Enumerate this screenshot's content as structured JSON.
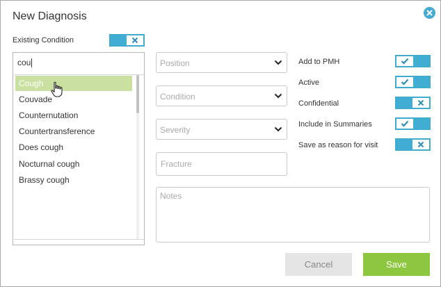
{
  "dialog": {
    "title": "New Diagnosis",
    "close_icon": "close-circle-icon"
  },
  "existing_condition": {
    "label": "Existing Condition",
    "state": "off"
  },
  "search": {
    "value": "cou",
    "results": [
      {
        "label": "Cough",
        "selected": true
      },
      {
        "label": "Couvade",
        "selected": false
      },
      {
        "label": "Counternutation",
        "selected": false
      },
      {
        "label": "Countertransference",
        "selected": false
      },
      {
        "label": "Does cough",
        "selected": false
      },
      {
        "label": "Nocturnal cough",
        "selected": false
      },
      {
        "label": "Brassy cough",
        "selected": false
      }
    ]
  },
  "fields": {
    "position_placeholder": "Position",
    "condition_placeholder": "Condition",
    "severity_placeholder": "Severity",
    "fracture_placeholder": "Fracture",
    "notes_placeholder": "Notes"
  },
  "toggles": [
    {
      "label": "Add to PMH",
      "state": "on"
    },
    {
      "label": "Active",
      "state": "on"
    },
    {
      "label": "Confidential",
      "state": "off"
    },
    {
      "label": "Include in Summaries",
      "state": "on"
    },
    {
      "label": "Save as reason for visit",
      "state": "off"
    }
  ],
  "buttons": {
    "cancel": "Cancel",
    "save": "Save"
  },
  "colors": {
    "toggle_blue": "#42add2",
    "selected_row": "#c9e0a0",
    "save_green": "#8dc63f",
    "cancel_gray": "#e5e5e5"
  }
}
